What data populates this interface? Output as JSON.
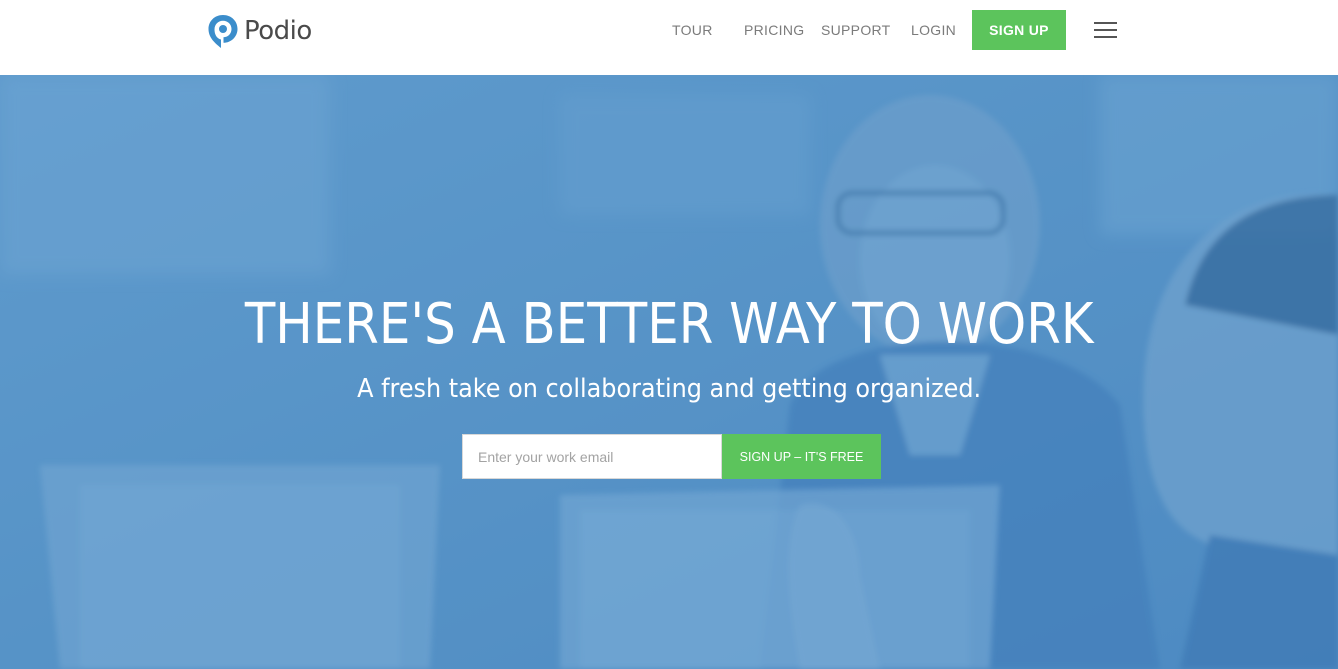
{
  "header": {
    "logo_text": "Podio",
    "nav": {
      "tour": "TOUR",
      "pricing": "PRICING",
      "support": "SUPPORT",
      "login": "LOGIN"
    },
    "signup_label": "SIGN UP",
    "menu_icon": "hamburger-icon"
  },
  "hero": {
    "title": "THERE'S A BETTER WAY TO WORK",
    "subtitle": "A fresh take on collaborating and getting organized.",
    "email_placeholder": "Enter your work email",
    "email_value": "",
    "cta_label": "SIGN UP – IT'S FREE"
  },
  "colors": {
    "accent_green": "#5cc45c",
    "hero_blue": "#5b97c8",
    "logo_blue": "#3b8dcb",
    "nav_text": "#7b7b7b"
  }
}
